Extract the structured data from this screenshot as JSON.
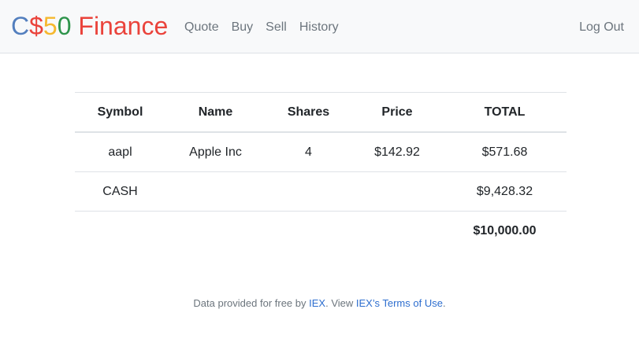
{
  "brand": {
    "part1": "C",
    "part2": "$",
    "part3": "5",
    "part4": "0",
    "part5": " Finance"
  },
  "nav": {
    "items": [
      {
        "label": "Quote"
      },
      {
        "label": "Buy"
      },
      {
        "label": "Sell"
      },
      {
        "label": "History"
      }
    ],
    "logout": "Log Out"
  },
  "table": {
    "headers": [
      "Symbol",
      "Name",
      "Shares",
      "Price",
      "TOTAL"
    ],
    "rows": [
      {
        "symbol": "aapl",
        "name": "Apple Inc",
        "shares": "4",
        "price": "$142.92",
        "total": "$571.68"
      },
      {
        "symbol": "CASH",
        "name": "",
        "shares": "",
        "price": "",
        "total": "$9,428.32"
      }
    ],
    "grand_total": "$10,000.00"
  },
  "footer": {
    "prefix": "Data provided for free by ",
    "iex_link": "IEX",
    "middle": ". View ",
    "terms_link": "IEX’s Terms of Use",
    "suffix": "."
  },
  "colors": {
    "brand_blue": "#537fbe",
    "brand_red": "#ea433b",
    "brand_yellow": "#f5b82e",
    "brand_green": "#2e944b",
    "link": "#2d6ecf"
  }
}
